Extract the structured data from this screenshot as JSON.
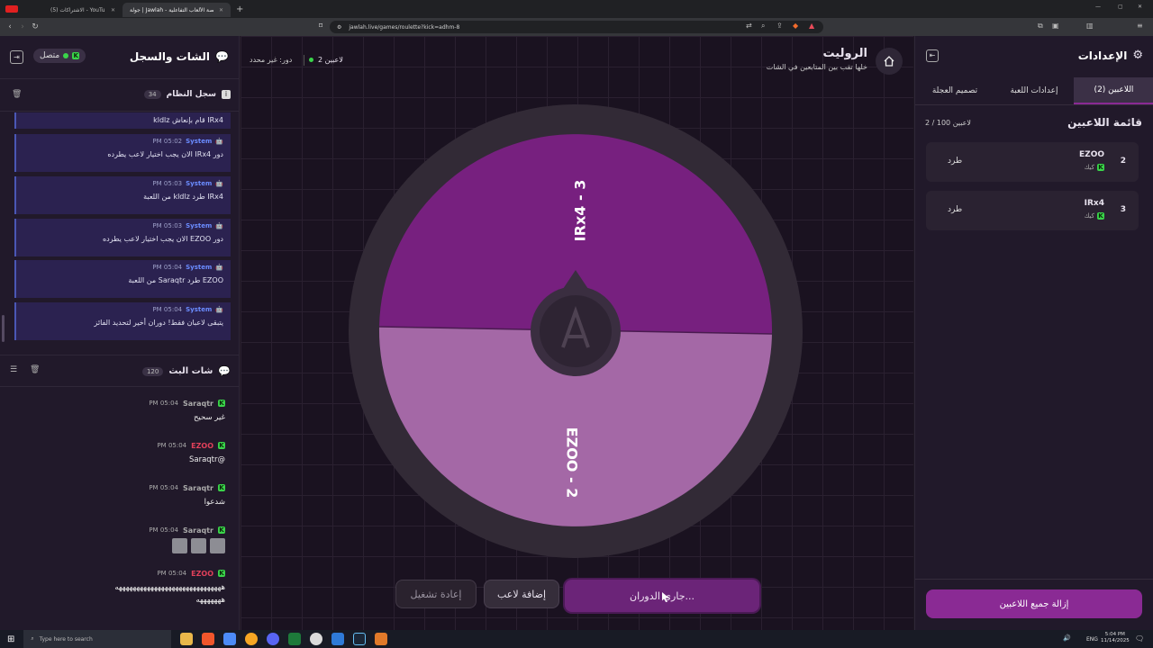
{
  "browser": {
    "tabs": [
      {
        "title": "(5) الاشتراكات - YouTube"
      },
      {
        "title": "جولة | Jawlah - منصة الألعاب التفاعلية",
        "active": true
      }
    ],
    "url": "jawlah.live/games/roulette?kick=adhm-8"
  },
  "chat_panel": {
    "title": "الشات والسجل",
    "status": "متصل",
    "system_log": {
      "title": "سجل النظام",
      "count": "34",
      "partial_first": "IRx4 قام بإنعاش kldlz",
      "messages": [
        {
          "sender": "System",
          "time": "05:02 PM",
          "text": "دور IRx4 الان يجب اختيار لاعب يطرده"
        },
        {
          "sender": "System",
          "time": "05:03 PM",
          "text": "IRx4 طرد kldlz من اللعبة"
        },
        {
          "sender": "System",
          "time": "05:03 PM",
          "text": "دور EZOO الان يجب اختيار لاعب يطرده"
        },
        {
          "sender": "System",
          "time": "05:04 PM",
          "text": "EZOO طرد Saraqtr من اللعبة"
        },
        {
          "sender": "System",
          "time": "05:04 PM",
          "text": "يتبقى لاعبان فقط! دوران أخير لتحديد الفائز"
        }
      ]
    },
    "stream_chat": {
      "title": "شات البث",
      "count": "120",
      "messages": [
        {
          "user": "Saraqtr",
          "color": "#ffffff",
          "time": "05:04 PM",
          "text": "غير سحيح"
        },
        {
          "user": "EZOO",
          "color": "#e0405a",
          "time": "05:04 PM",
          "text": "@Saraqtr"
        },
        {
          "user": "Saraqtr",
          "color": "#ffffff",
          "time": "05:04 PM",
          "text": "شدعوا"
        },
        {
          "user": "Saraqtr",
          "color": "#ffffff",
          "time": "05:04 PM",
          "text": ""
        },
        {
          "user": "EZOO",
          "color": "#e0405a",
          "time": "05:04 PM",
          "text": "ههههههههههههههههههههههههههههههه"
        }
      ],
      "last_extra": "هههههههه"
    }
  },
  "game": {
    "title": "الروليت",
    "subtitle": "خلها تقب بين المتابعين في الشات",
    "players_badge": "2 لاعبين",
    "turn": "دور: غير محدد",
    "wheel": {
      "segments": [
        {
          "label": "IRx4 - 3",
          "color": "#77207f"
        },
        {
          "label": "EZOO - 2",
          "color": "#a468a6"
        }
      ]
    },
    "buttons": {
      "spin": "جاري الدوران...",
      "add_player": "إضافة لاعب",
      "restart": "إعادة تشغيل"
    }
  },
  "settings": {
    "title": "الإعدادات",
    "tabs": [
      "اللاعبين (2)",
      "إعدادات اللعبة",
      "تصميم العجلة"
    ],
    "players_title": "قائمة اللاعبين",
    "players_count": "2 / 100 لاعبين",
    "players": [
      {
        "rank": "2",
        "name": "EZOO",
        "platform": "كيك",
        "action": "طرد"
      },
      {
        "rank": "3",
        "name": "IRx4",
        "platform": "كيك",
        "action": "طرد"
      }
    ],
    "remove_all": "إزالة جميع اللاعبين"
  },
  "taskbar": {
    "search": "Type here to search",
    "lang": "ENG",
    "time": "5:04 PM",
    "date": "11/14/2025"
  },
  "colors": {
    "accent": "#8a2a94",
    "kick_green": "#3ad44a",
    "system_blue": "#6b8cff"
  }
}
